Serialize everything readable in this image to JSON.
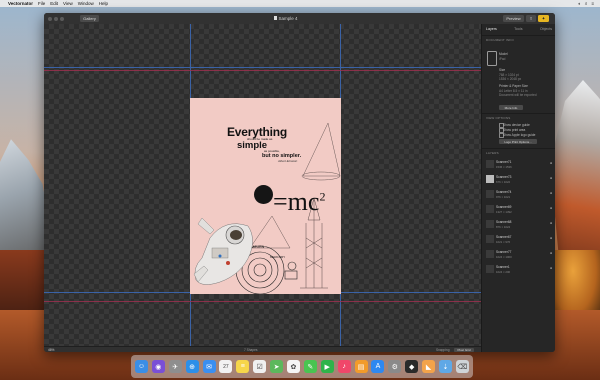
{
  "menubar": {
    "app_name": "Vectornator",
    "items": [
      "File",
      "Edit",
      "View",
      "Window",
      "Help"
    ],
    "right_items": [
      "◐",
      "⌕",
      "≡"
    ]
  },
  "window": {
    "title": "Sample 4",
    "back_button": "Gallery",
    "preview_button": "Preview",
    "share_icon": "share-icon",
    "bulb_icon": "lightbulb-icon"
  },
  "artboard": {
    "headline": "Everything",
    "make_text": "should be made as",
    "simple": "simple",
    "possible_text": "as possible,",
    "no_simpler": "but no simpler.",
    "author": "Albert Einstein",
    "equation_main": "=mc",
    "equation_sup": "2",
    "apple": ""
  },
  "inspector": {
    "tabs": [
      "Layers",
      "Tools",
      "Objects"
    ],
    "active_tab": "Layers",
    "document_info_title": "DOCUMENT INFO",
    "model_label": "Model",
    "model_value": "iPad",
    "size_label": "Size",
    "size_value1": "768 × 1024 pt",
    "size_value2": "1536 × 2048 px",
    "printer_label": "Printer & Paper Size",
    "printer_text1": "A4 Letter 8.5 × 11 in",
    "printer_text2": "Document will be exported",
    "more_info_button": "More Info",
    "view_options_title": "VIEW OPTIONS",
    "option1": "Show device guide",
    "option2": "Show print area",
    "option3": "Show Apple logo guide",
    "logo_button": "Logo Print Options...",
    "layers_title": "LAYERS",
    "layers": [
      {
        "name": "Scanner71",
        "dims": "1536 × 1536"
      },
      {
        "name": "Scanner73",
        "dims": "676 × 1022"
      },
      {
        "name": "Scanner74",
        "dims": "976 × 1021"
      },
      {
        "name": "Scanner69",
        "dims": "1327 × 1392"
      },
      {
        "name": "Scanner68",
        "dims": "876 × 1024"
      },
      {
        "name": "Scanner67",
        "dims": "1021 × 976"
      },
      {
        "name": "Scanner77",
        "dims": "1024 × 1000"
      },
      {
        "name": "Scanner1",
        "dims": "1024 × 200"
      }
    ],
    "visible_icon": "●"
  },
  "statusbar": {
    "zoom": "46%",
    "center": "7 Shapes",
    "snap_label": "Snapping",
    "pixel_button": "Pixel Grid"
  },
  "dock": {
    "icons": [
      {
        "name": "finder-icon",
        "color": "#3a8ee6",
        "glyph": "☺"
      },
      {
        "name": "siri-icon",
        "color": "#7a4fd6",
        "glyph": "◉"
      },
      {
        "name": "launchpad-icon",
        "color": "#8e8e8e",
        "glyph": "✈"
      },
      {
        "name": "safari-icon",
        "color": "#2d8fe8",
        "glyph": "⊕"
      },
      {
        "name": "mail-icon",
        "color": "#3b8ff1",
        "glyph": "✉"
      },
      {
        "name": "calendar-icon",
        "color": "#f2f2f2",
        "glyph": "27"
      },
      {
        "name": "notes-icon",
        "color": "#f6d64a",
        "glyph": "≡"
      },
      {
        "name": "reminders-icon",
        "color": "#f0f0f0",
        "glyph": "☑"
      },
      {
        "name": "maps-icon",
        "color": "#5cb85c",
        "glyph": "➤"
      },
      {
        "name": "photos-icon",
        "color": "#f5f5f5",
        "glyph": "✿"
      },
      {
        "name": "messages-icon",
        "color": "#49c451",
        "glyph": "✎"
      },
      {
        "name": "facetime-icon",
        "color": "#2fb34a",
        "glyph": "▶"
      },
      {
        "name": "music-icon",
        "color": "#f0476a",
        "glyph": "♪"
      },
      {
        "name": "books-icon",
        "color": "#f29b2a",
        "glyph": "▤"
      },
      {
        "name": "appstore-icon",
        "color": "#2f88f0",
        "glyph": "A"
      },
      {
        "name": "preferences-icon",
        "color": "#8a8a8a",
        "glyph": "⚙"
      },
      {
        "name": "vectornator-icon",
        "color": "#2a2a2a",
        "glyph": "◆"
      },
      {
        "name": "app-icon",
        "color": "#f3a34a",
        "glyph": "◣"
      },
      {
        "name": "downloads-icon",
        "color": "#5fa8e6",
        "glyph": "⇣"
      },
      {
        "name": "trash-icon",
        "color": "#cfd4d8",
        "glyph": "⌫"
      }
    ]
  }
}
